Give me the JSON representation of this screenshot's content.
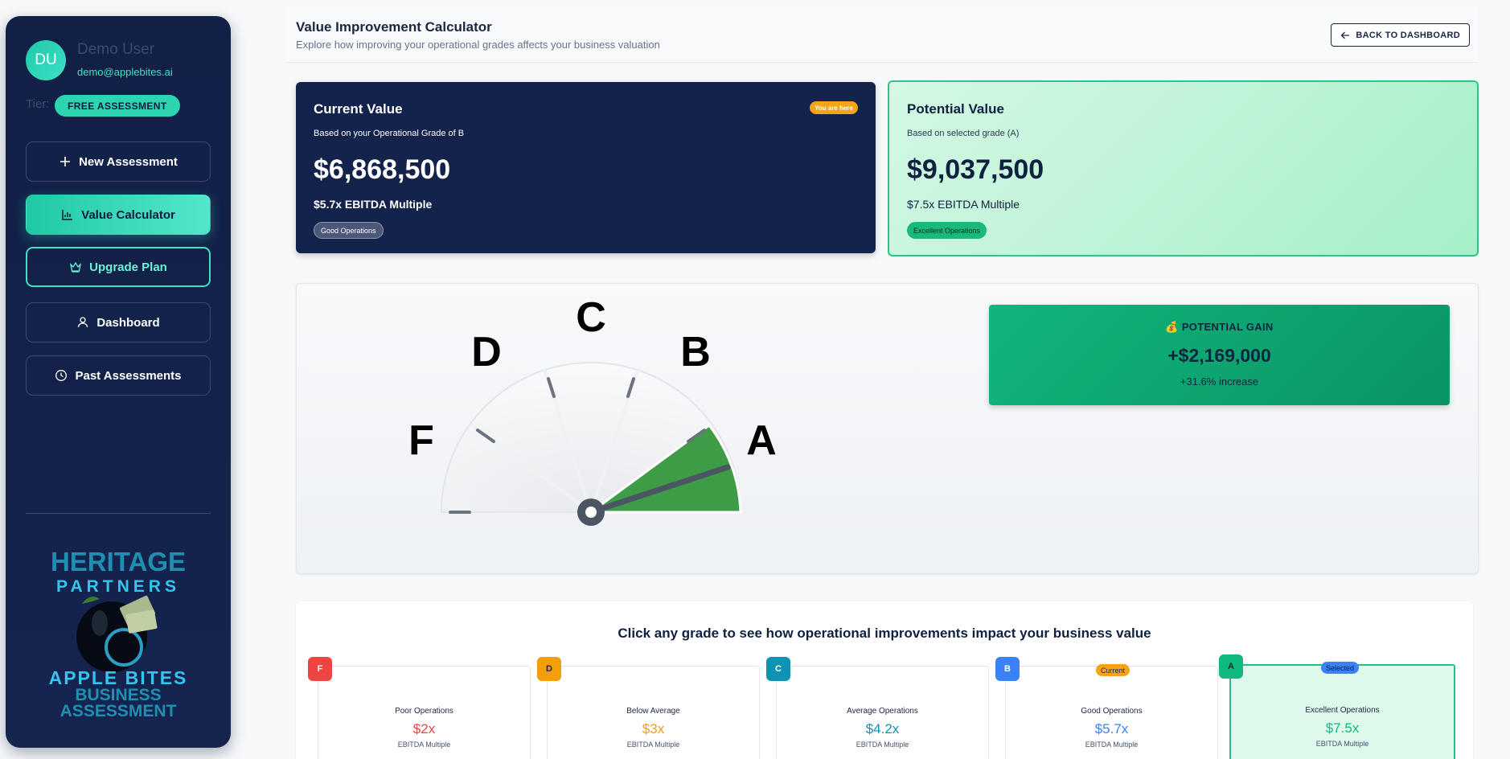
{
  "user": {
    "initials": "DU",
    "name": "Demo User",
    "email": "demo@applebites.ai",
    "tier_label": "Tier:",
    "tier": "FREE ASSESSMENT"
  },
  "nav": {
    "new_assessment": "New Assessment",
    "value_calculator": "Value Calculator",
    "upgrade_plan": "Upgrade Plan",
    "dashboard": "Dashboard",
    "past_assessments": "Past Assessments"
  },
  "logo": {
    "line1": "HERITAGE",
    "line2": "PARTNERS",
    "line3": "APPLE BITES",
    "line4": "BUSINESS",
    "line5": "ASSESSMENT"
  },
  "header": {
    "title": "Value Improvement Calculator",
    "subtitle": "Explore how improving your operational grades affects your business valuation",
    "back_label": "BACK TO DASHBOARD"
  },
  "current": {
    "title": "Current Value",
    "badge": "You are here",
    "subtitle": "Based on your Operational Grade of B",
    "value": "$6,868,500",
    "multiple": "$5.7x EBITDA Multiple",
    "tag": "Good Operations"
  },
  "potential": {
    "title": "Potential Value",
    "subtitle": "Based on selected grade (A)",
    "value": "$9,037,500",
    "multiple": "$7.5x EBITDA Multiple",
    "tag": "Excellent Operations"
  },
  "gauge": {
    "labels": [
      "F",
      "D",
      "C",
      "B",
      "A"
    ],
    "selected": "A"
  },
  "gain": {
    "title": "💰 POTENTIAL GAIN",
    "value": "+$2,169,000",
    "percent": "+31.6% increase"
  },
  "grades_section": {
    "instruction": "Click any grade to see how operational improvements impact your business value",
    "grades": [
      {
        "letter": "F",
        "name": "Poor Operations",
        "multiple": "$2x",
        "label": "EBITDA Multiple",
        "color": "#ef4444"
      },
      {
        "letter": "D",
        "name": "Below Average",
        "multiple": "$3x",
        "label": "EBITDA Multiple",
        "color": "#f59e0b"
      },
      {
        "letter": "C",
        "name": "Average Operations",
        "multiple": "$4.2x",
        "label": "EBITDA Multiple",
        "color": "#0e93b3"
      },
      {
        "letter": "B",
        "name": "Good Operations",
        "multiple": "$5.7x",
        "label": "EBITDA Multiple",
        "color": "#3b82f6",
        "tag": "Current"
      },
      {
        "letter": "A",
        "name": "Excellent Operations",
        "multiple": "$7.5x",
        "label": "EBITDA Multiple",
        "color": "#10b981",
        "tag": "Selected"
      }
    ]
  }
}
